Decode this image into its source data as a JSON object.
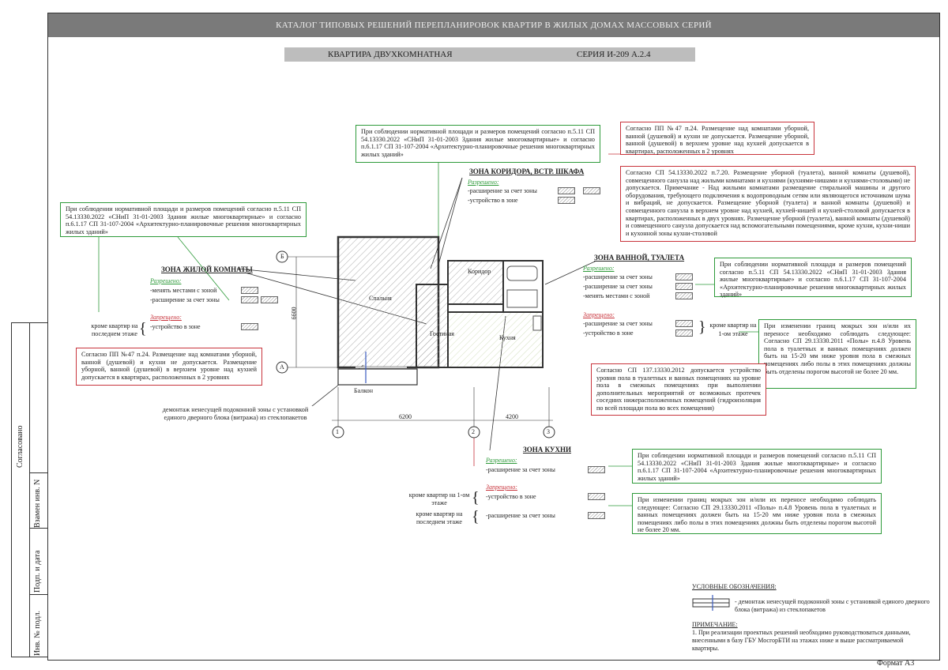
{
  "header": {
    "title": "КАТАЛОГ ТИПОВЫХ РЕШЕНИЙ ПЕРЕПЛАНИРОВОК КВАРТИР В ЖИЛЫХ ДОМАХ МАССОВЫХ СЕРИЙ"
  },
  "subheader": {
    "apartment": "КВАРТИРА ДВУХКОМНАТНАЯ",
    "series": "СЕРИЯ И-209 А.2.4"
  },
  "side_stamp": {
    "agreed": "Согласовано",
    "replaced": "Взамен инв. N",
    "sign_date": "Подп. и дата",
    "inv_no": "Инв. № подл."
  },
  "format": "Формат А3",
  "notes": {
    "top_center_green": "При соблюдении нормативной площади и размеров помещений согласно п.5.11 СП 54.13330.2022 «СНиП 31-01-2003 Здания жилые многоквартирные» и согласно п.6.1.17 СП 31-107-2004 «Архитектурно-планировочные решения многоквартирных жилых зданий»",
    "left_green": "При соблюдении нормативной площади и размеров помещений согласно п.5.11 СП 54.13330.2022 «СНиП 31-01-2003 Здания жилые многоквартирные» и согласно п.6.1.17 СП 31-107-2004 «Архитектурно-планировочные решения многоквартирных жилых зданий»",
    "left_red": "Согласно ПП №47 п.24. Размещение над комнатами уборной, ванной (душевой) и кухни не допускается. Размещение уборной, ванной (душевой) в верхнем уровне над кухней допускается в квартирах, расположенных в 2 уровнях",
    "top_right_red": "Согласно ПП №47 п.24. Размещение над комнатами уборной, ванной (душевой) и кухни не допускается. Размещение уборной, ванной (душевой) в верхнем уровне над кухней допускается в квартирах, расположенных в 2 уровнях",
    "right_red_big": "Согласно СП 54.13330.2022 п.7.20. Размещение уборной (туалета), ванной комнаты (душевой), совмещенного санузла над жилыми комнатами и кухнями (кухнями-нишами и кухнями-столовыми) не допускается. Примечание - Над жилыми комнатами размещение стиральной машины и другого оборудования, требующего подключения к водопроводным сетям или являющегося источником шума и вибраций, не допускается. Размещение уборной (туалета) и ванной комнаты (душевой) и совмещенного санузла в верхнем уровне над кухней, кухней-нишей и кухней-столовой допускается в квартирах, расположенных в двух уровнях. Размещение уборной (туалета), ванной комнаты (душевой) и совмещенного санузла допускается над вспомогательными помещениями, кроме кухни, кухни-ниши и кухонной зоны кухни-столовой",
    "bath_green": "При соблюдении нормативной площади и размеров помещений согласно п.5.11 СП 54.13330.2022 «СНиП 31-01-2003 Здания жилые многоквартирные» и согласно п.6.1.17 СП 31-107-2004 «Архитектурно-планировочные решения многоквартирных жилых зданий»",
    "wet_green": "При изменении границ мокрых зон и/или их переносе необходимо соблюдать следующее: Согласно СП 29.13330.2011 «Полы» п.4.8 Уровень пола в туалетных и ванных помещениях должен быть на 15-20 мм ниже уровня пола в смежных помещениях либо полы в этих помещениях должны быть отделены порогом высотой не более 20 мм.",
    "waterproof_red": "Согласно СП 137.13330.2012 допускается устройство уровня пола в туалетных и ванных помещениях на уровне пола в смежных помещениях при выполнении дополнительных мероприятий от возможных протечек соседних нижерасположенных помещений (гидроизоляция по всей площади пола во всех помещения)",
    "kitchen_green1": "При соблюдении нормативной площади и размеров помещений согласно п.5.11 СП 54.13330.2022 «СНиП 31-01-2003 Здания жилые многоквартирные» и согласно п.6.1.17 СП 31-107-2004 «Архитектурно-планировочные решения многоквартирных жилых зданий»",
    "kitchen_green2": "При изменении границ мокрых зон и/или их переносе необходимо соблюдать следующее: Согласно СП 29.13330.2011 «Полы» п.4.8 Уровень пола в туалетных и ванных помещениях должен быть на 15-20 мм ниже уровня пола в смежных помещениях либо полы в этих помещениях должны быть отделены порогом высотой не более 20 мм.",
    "demount": "демонтаж ненесущей подоконной зоны с установкой единого дверного блока (витража) из стеклопакетов"
  },
  "zones": {
    "corridor": {
      "title": "ЗОНА КОРИДОРА, ВСТР. ШКАФА",
      "allowed": "Разрешено:",
      "items": [
        "-расширение за счет зоны",
        "-устройство в зоне"
      ]
    },
    "living": {
      "title": "ЗОНА ЖИЛОЙ КОМНАТЫ",
      "allowed": "Разрешено:",
      "items": [
        "-менять местами с зоной",
        "-расширение за счет зоны"
      ],
      "forbidden": "Запрещено:",
      "forbidden_items": [
        "-устройство в зоне"
      ],
      "except": "кроме квартир на последнем этаже"
    },
    "bath": {
      "title": "ЗОНА ВАННОЙ, ТУАЛЕТА",
      "allowed": "Разрешено:",
      "items": [
        "-расширение за счет зоны",
        "-расширение за счет зоны",
        "-менять местами с зоной"
      ],
      "forbidden": "Запрещено:",
      "forbidden_items": [
        "-расширение за счет зоны",
        "-устройство в зоне"
      ],
      "except": "кроме квартир на 1-ом этаже"
    },
    "kitchen": {
      "title": "ЗОНА КУХНИ",
      "allowed": "Разрешено:",
      "items": [
        "-расширение за счет зоны"
      ],
      "forbidden": "Запрещено:",
      "forbidden_items": [
        "-устройство в зоне",
        "-расширение за счет зоны"
      ],
      "except1": "кроме квартир на 1-ом этаже",
      "except2": "кроме квартир на последнем этаже"
    }
  },
  "plan": {
    "rooms": {
      "bedroom": "Спальня",
      "living": "Гостиная",
      "corridor": "Коридор",
      "kitchen": "Кухня",
      "balcony": "Балкон"
    },
    "dims": {
      "d1": "6200",
      "d2": "4200",
      "height": "6600"
    },
    "axes": {
      "a1": "1",
      "a2": "2",
      "a3": "3",
      "aA": "А",
      "aB": "Б"
    }
  },
  "legend": {
    "title": "УСЛОВНЫЕ ОБОЗНАЧЕНИЯ:",
    "item": "- демонтаж ненесущей подоконной зоны с установкой единого дверного блока (витража) из стеклопакетов",
    "note_title": "ПРИМЕЧАНИЕ:",
    "note": "1. При реализации проектных решений необходимо руководствоваться данными, внесенными в базу ГБУ МосгорБТИ на этажах ниже и выше рассматриваемой квартиры."
  },
  "colors": {
    "green": "#2e9a3a",
    "red": "#c8343c",
    "header": "#7a7a7a",
    "subheader": "#bdbdbd"
  }
}
